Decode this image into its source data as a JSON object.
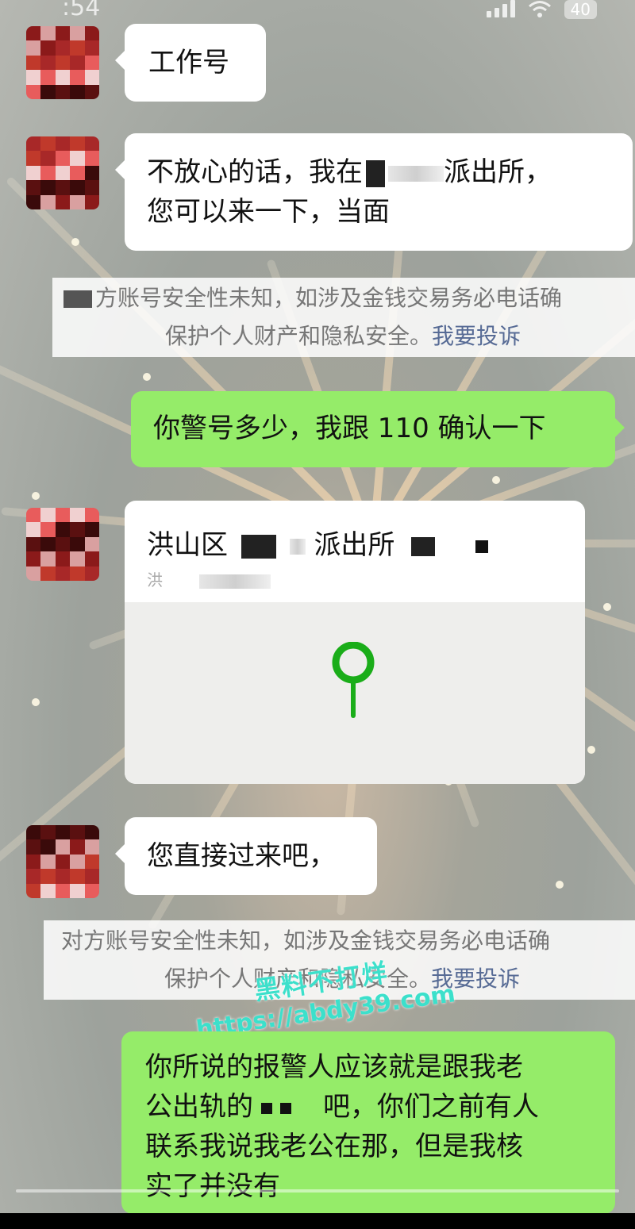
{
  "status": {
    "time": ":54",
    "battery": "40"
  },
  "messages": {
    "m1": "工作号",
    "m2_a": "不放心的话，我在",
    "m2_b": "派出所，",
    "m2_c": "您可以来一下，当面",
    "m3": "你警号多少，我跟 110 确认一下",
    "m4_location_title_a": "洪山区",
    "m4_location_title_b": "派出所",
    "m4_location_sub": "洪",
    "m5": "您直接过来吧，",
    "m6_a": "你所说的报警人应该就是跟我老",
    "m6_b": "公出轨的",
    "m6_c": "吧，你们之前有人",
    "m6_d": "联系我说我老公在那，但是我核",
    "m6_e": "实了并没有"
  },
  "notice1": {
    "line1": "方账号安全性未知，如涉及金钱交易务必电话确",
    "line2": "保护个人财产和隐私安全。",
    "link": "我要投诉"
  },
  "notice2": {
    "line1": "对方账号安全性未知，如涉及金钱交易务必电话确",
    "line2": "保护个人财产和隐私安全。",
    "link": "我要投诉"
  },
  "watermark": {
    "line1": "黑料不打烊",
    "line2": "https://abdy39.com"
  },
  "colors": {
    "sent_bubble": "#95ec69",
    "received_bubble": "#ffffff",
    "link": "#576b95",
    "pin": "#1aad19",
    "watermark": "#3ce0cb"
  }
}
